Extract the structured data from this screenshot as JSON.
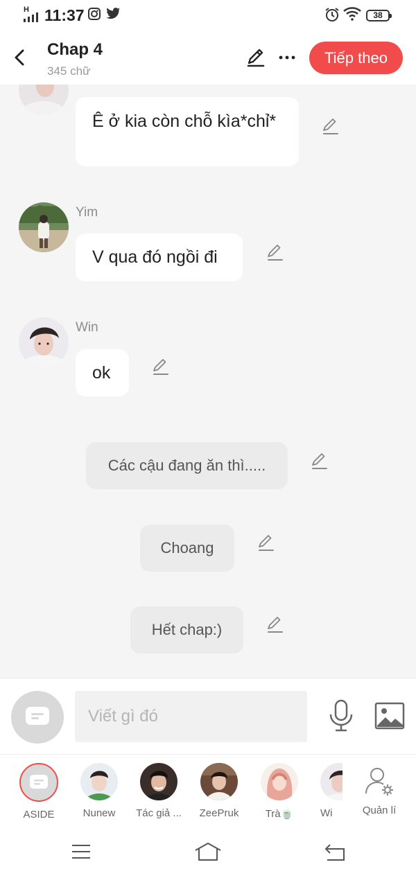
{
  "status": {
    "time": "11:37",
    "network": "H",
    "battery": "38"
  },
  "header": {
    "title": "Chap 4",
    "word_count": "345 chữ",
    "next_label": "Tiếp theo"
  },
  "messages": [
    {
      "type": "bubble",
      "name": "",
      "text": "Ê ở kia còn chỗ kìa*chỉ*"
    },
    {
      "type": "bubble",
      "name": "Yim",
      "text": "V qua đó ngồi đi"
    },
    {
      "type": "bubble",
      "name": "Win",
      "text": "ok"
    },
    {
      "type": "narration",
      "text": "Các cậu đang ăn thì....."
    },
    {
      "type": "narration",
      "text": "Choang"
    },
    {
      "type": "narration",
      "text": "Hết chap:)"
    }
  ],
  "input": {
    "placeholder": "Viết gì đó"
  },
  "characters": [
    {
      "name": "ASIDE"
    },
    {
      "name": "Nunew"
    },
    {
      "name": "Tác giả ..."
    },
    {
      "name": "ZeePruk"
    },
    {
      "name": "Trà🍵"
    },
    {
      "name": "Wi"
    },
    {
      "name": "Quản lí"
    }
  ],
  "colors": {
    "accent": "#f24b4b",
    "background": "#f5f5f5",
    "bubble": "#ffffff",
    "narration": "#ebebeb"
  },
  "icons": [
    "back-icon",
    "edit-icon",
    "more-icon",
    "pencil-icon",
    "mic-icon",
    "image-icon",
    "settings-user-icon",
    "menu-icon",
    "home-icon",
    "back-nav-icon"
  ]
}
